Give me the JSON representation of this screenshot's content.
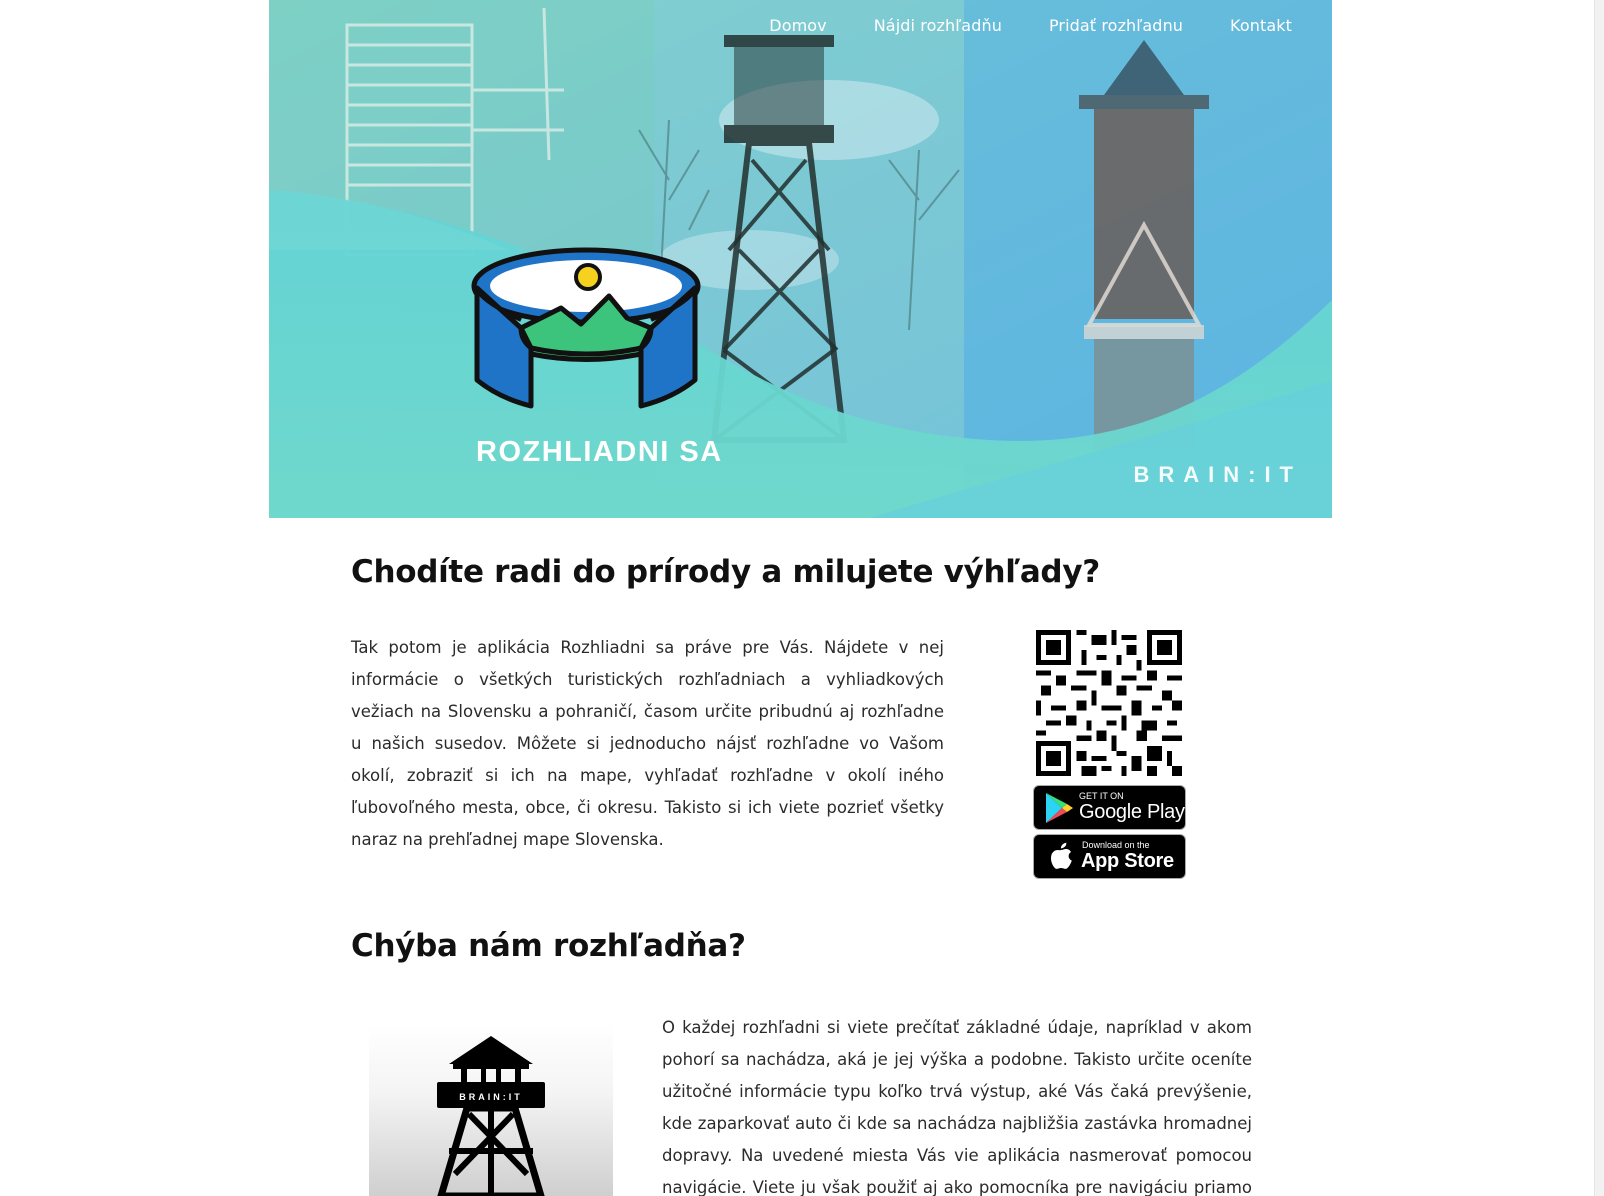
{
  "nav": {
    "items": [
      {
        "label": "Domov"
      },
      {
        "label": "Nájdi rozhľadňu"
      },
      {
        "label": "Pridať rozhľadnu"
      },
      {
        "label": "Kontakt"
      }
    ]
  },
  "hero": {
    "app_name": "ROZHLIADNI SA",
    "company_wordmark": "BRAIN:IT"
  },
  "intro": {
    "heading": "Chodíte radi do prírody a milujete výhľady?",
    "text": "Tak potom je aplikácia Rozhliadni sa práve pre Vás. Nájdete v nej informácie o všetkých turistických rozhľadniach a vyhliadkových vežiach na Slovensku a pohraničí, časom určite pribudnú aj rozhľadne u našich susedov. Môžete si jednoducho nájsť rozhľadne vo Vašom okolí, zobraziť si ich na mape, vyhľadať rozhľadne v okolí iného ľubovoľného mesta, obce, či okresu. Takisto si ich viete pozrieť všetky naraz na prehľadnej mape Slovenska."
  },
  "stores": {
    "google": {
      "small": "GET IT ON",
      "big": "Google Play"
    },
    "apple": {
      "small": "Download on the",
      "big": "App Store"
    }
  },
  "missing": {
    "heading": "Chýba nám rozhľadňa?",
    "image_caption": "BRAIN:IT",
    "text": "O každej rozhľadni si viete prečítať základné údaje, napríklad v akom pohorí sa nachádza, aká je jej výška a podobne. Takisto určite oceníte užitočné informácie typu koľko trvá výstup, aké Vás čaká prevýšenie, kde zaparkovať auto či kde sa nachádza najbližšia zastávka hromadnej dopravy. Na uvedené miesta Vás vie aplikácia nasmerovať pomocou navigácie. Viete ju však použiť aj ako pomocníka pre navigáciu priamo v"
  },
  "colors": {
    "hero_teal": "#6fd8cf",
    "hero_sky": "#5ab6e0",
    "logo_blue": "#1f74c8",
    "logo_green": "#39c37a"
  },
  "icons": [
    "qr-code-icon",
    "google-play-icon",
    "apple-icon",
    "tower-logo-icon"
  ]
}
